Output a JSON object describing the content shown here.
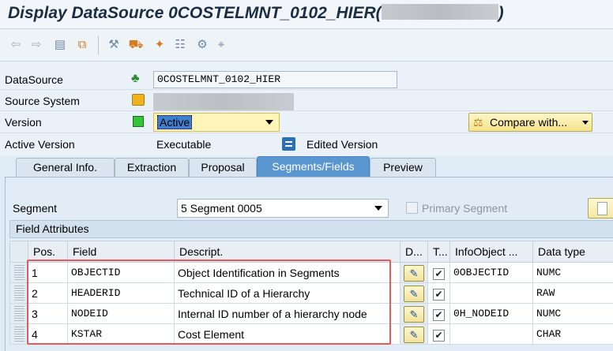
{
  "window": {
    "title": "Display DataSource 0COSTELMNT_0102_HIER(",
    "title_close": ")"
  },
  "toolbar": {
    "icons": [
      "back-arrow-icon",
      "forward-arrow-icon",
      "object-list-icon",
      "hierarchy-icon",
      "tools-icon",
      "transport-icon",
      "magic-wand-icon",
      "structure-icon",
      "settings-icon",
      "where-used-icon"
    ]
  },
  "header": {
    "datasource": {
      "label": "DataSource",
      "value": "0COSTELMNT_0102_HIER"
    },
    "source_system": {
      "label": "Source System",
      "value": ""
    },
    "version": {
      "label": "Version",
      "selected": "Active"
    },
    "compare_button": {
      "label": "Compare with..."
    },
    "active_version": {
      "label": "Active Version",
      "value": "Executable",
      "edited_label": "Edited Version"
    }
  },
  "tabs": [
    {
      "label": "General Info.",
      "active": false
    },
    {
      "label": "Extraction",
      "active": false
    },
    {
      "label": "Proposal",
      "active": false
    },
    {
      "label": "Segments/Fields",
      "active": true
    },
    {
      "label": "Preview",
      "active": false
    }
  ],
  "segment": {
    "label": "Segment",
    "selected": "5 Segment 0005",
    "primary_label": "Primary Segment"
  },
  "field_attributes": {
    "title": "Field Attributes",
    "columns": [
      "Pos.",
      "Field",
      "Descript.",
      "D...",
      "T...",
      "InfoObject ...",
      "Data type"
    ],
    "rows": [
      {
        "pos": "1",
        "field": "OBJECTID",
        "descr": "Object Identification in Segments",
        "transfer": true,
        "infoobject": "0OBJECTID",
        "datatype": "NUMC"
      },
      {
        "pos": "2",
        "field": "HEADERID",
        "descr": "Technical ID of a Hierarchy",
        "transfer": true,
        "infoobject": "",
        "datatype": "RAW"
      },
      {
        "pos": "3",
        "field": "NODEID",
        "descr": "Internal ID number of a hierarchy node",
        "transfer": true,
        "infoobject": "0H_NODEID",
        "datatype": "NUMC"
      },
      {
        "pos": "4",
        "field": "KSTAR",
        "descr": "Cost Element",
        "transfer": true,
        "infoobject": "",
        "datatype": "CHAR"
      }
    ]
  },
  "colors": {
    "active_tab": "#5a96cf",
    "highlight_box": "#e55b5b",
    "yellow_field": "#fff5b8"
  }
}
